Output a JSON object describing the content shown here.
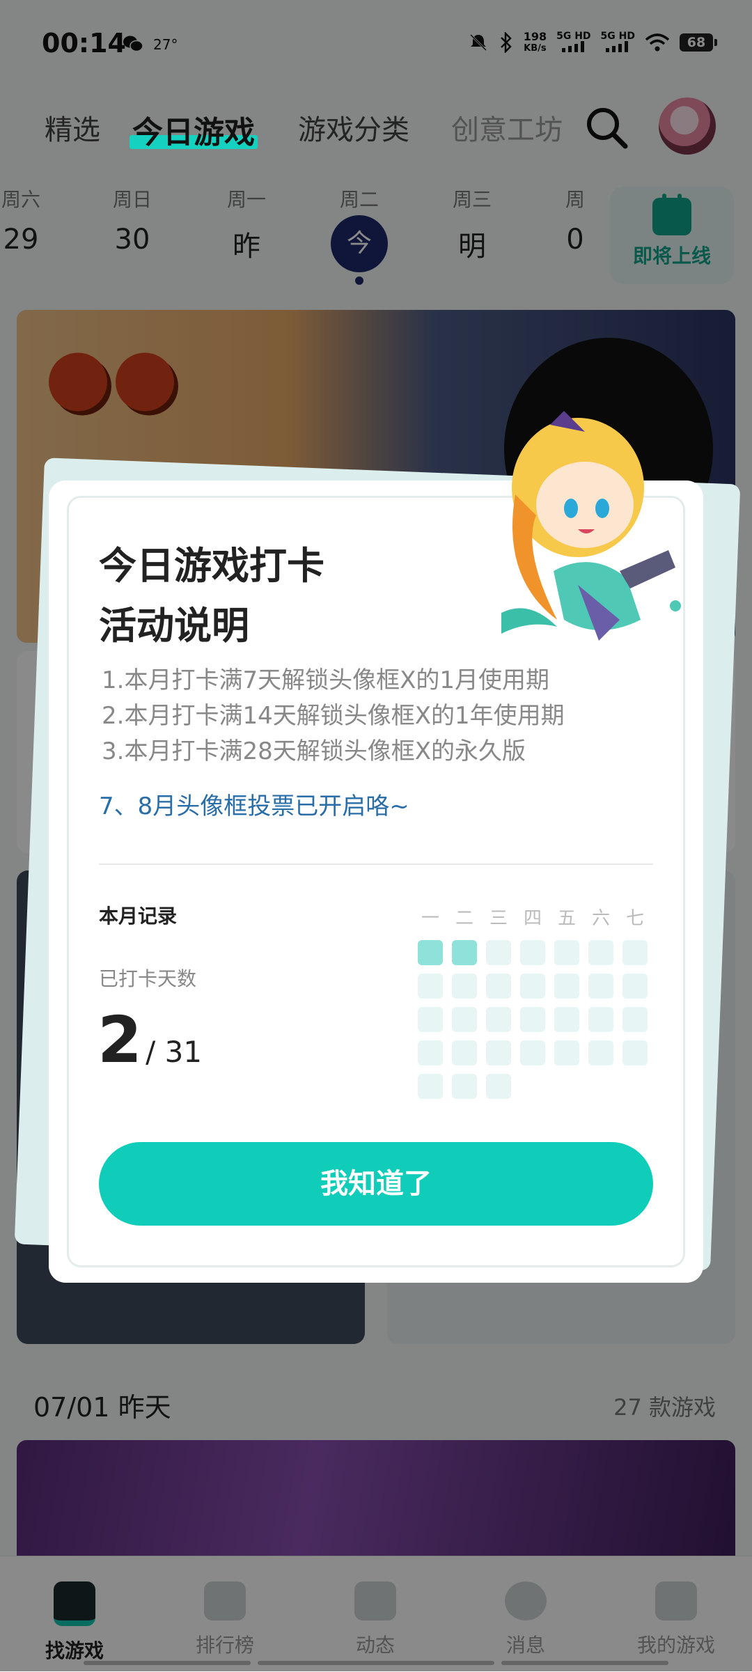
{
  "status_bar": {
    "time": "00:14",
    "temperature": "27°",
    "speed_value": "198",
    "speed_unit": "KB/s",
    "sim1": "5G HD",
    "sim2": "5G HD",
    "battery": "68"
  },
  "top_nav": {
    "tabs": [
      {
        "label": "精选"
      },
      {
        "label": "今日游戏"
      },
      {
        "label": "游戏分类"
      },
      {
        "label": "创意工坊"
      }
    ],
    "active_index": 1
  },
  "date_strip": {
    "days": [
      {
        "weekday": "周六",
        "date": "29"
      },
      {
        "weekday": "周日",
        "date": "30"
      },
      {
        "weekday": "周一",
        "date": "昨"
      },
      {
        "weekday": "周二",
        "date": "今"
      },
      {
        "weekday": "周三",
        "date": "明"
      },
      {
        "weekday": "周",
        "date": "0"
      }
    ],
    "upcoming_label": "即将上线"
  },
  "feed": {
    "section_date": "07/01 昨天",
    "section_count": "27 款游戏"
  },
  "dialog": {
    "title_line1": "今日游戏打卡",
    "title_line2": "活动说明",
    "rules": [
      "1.本月打卡满7天解锁头像框X的1月使用期",
      "2.本月打卡满14天解锁头像框X的1年使用期",
      "3.本月打卡满28天解锁头像框X的永久版"
    ],
    "link": "7、8月头像框投票已开启咯~",
    "record_title": "本月记录",
    "checked_label": "已打卡天数",
    "checked_days": "2",
    "total_days": "/ 31",
    "weekdays": [
      "一",
      "二",
      "三",
      "四",
      "五",
      "六",
      "七"
    ],
    "checked_cells": 2,
    "total_cells": 31,
    "confirm_label": "我知道了"
  },
  "bottom_nav": [
    {
      "label": "找游戏"
    },
    {
      "label": "排行榜"
    },
    {
      "label": "动态"
    },
    {
      "label": "消息"
    },
    {
      "label": "我的游戏"
    }
  ],
  "colors": {
    "accent": "#10cdb9",
    "link": "#2a6ea7",
    "today": "#1f2a6a"
  }
}
